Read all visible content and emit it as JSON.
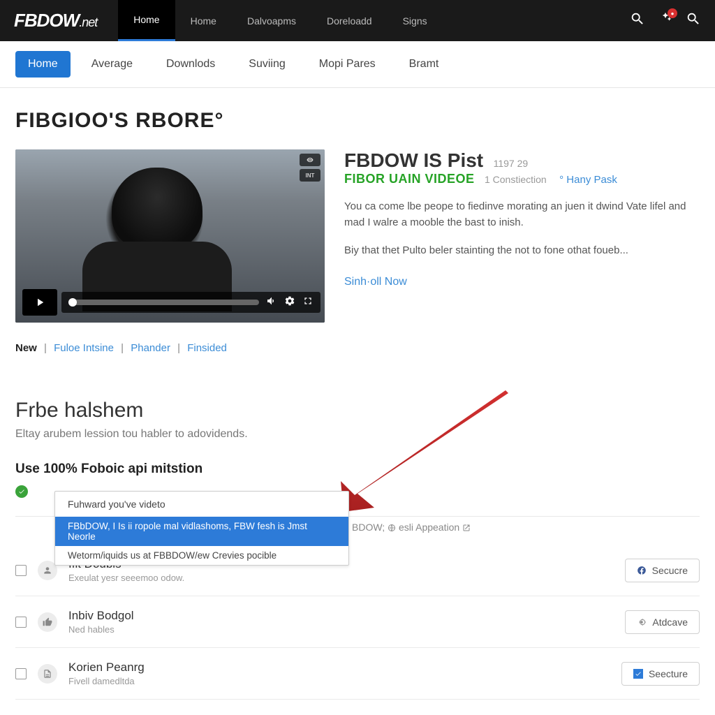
{
  "logo": {
    "main": "FBDOW",
    "suffix": ".net"
  },
  "top_nav": [
    "Home",
    "Home",
    "Dalvoapms",
    "Doreloadd",
    "Signs"
  ],
  "notif_badge": "●",
  "sec_nav": [
    "Home",
    "Average",
    "Downlods",
    "Suviing",
    "Mopi Pares",
    "Bramt"
  ],
  "page_title": "FIBGIOO'S RBORE°",
  "video": {
    "badge1": "👁",
    "badge2": "INT"
  },
  "hero": {
    "heading": "FBDOW IS Pist",
    "meta": "1197 29",
    "sub": "FIBOR UAIN VIDEOE",
    "sub_meta": "1 Constiection",
    "sub_link": "° Hany Pask",
    "desc1": "You ca come lbe peope to fiedinve morating an juen it dwind Vate lifel and mad I walre a mooble the bast to inish.",
    "desc2": "Biy that thet Pulto beler stainting the not to fone othat foueb...",
    "cta": "Sinh·oll Now"
  },
  "filters": {
    "new": "New",
    "a": "Fuloe Intsine",
    "b": "Phander",
    "c": "Finsided"
  },
  "lower": {
    "title": "Frbe halshem",
    "sub": "Eltay arubem lession tou habler to adovidends.",
    "head": "Use 100% Foboic api mitstion"
  },
  "autocomplete": {
    "search": "Fuhward you've videto",
    "opt1": "FBbDOW, I Is ii ropole mal vidlashoms, FBW fesh is Jmst Neorle",
    "opt2": "Wetorm/iquids us at FBBDOW/ew Crevies pocible"
  },
  "inline_hint": {
    "pre": "BDOW;",
    "text": "esli Appeation"
  },
  "rows": [
    {
      "title": "Ifit Doubls",
      "desc": "Exeulat yesr seeemoo odow.",
      "btn": "Secucre"
    },
    {
      "title": "Inbiv Bodgol",
      "desc": "Ned hables",
      "btn": "Atdcave"
    },
    {
      "title": "Korien Peanrg",
      "desc": "Fivell damedltda",
      "btn": "Seecture"
    }
  ]
}
